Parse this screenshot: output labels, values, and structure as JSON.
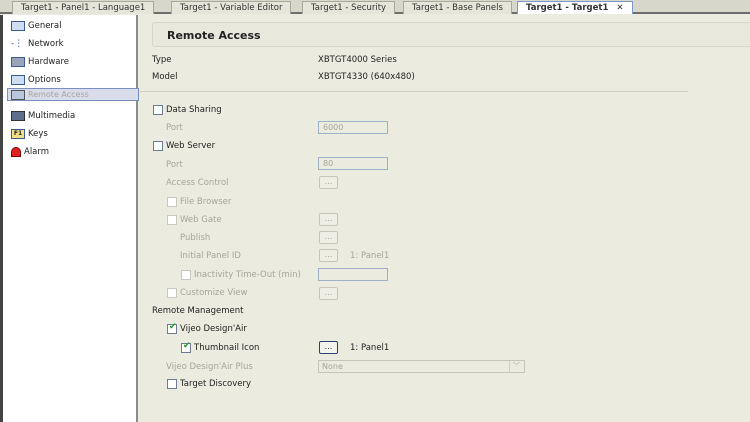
{
  "tabs": [
    {
      "label": "Target1 - Panel1 - Language1"
    },
    {
      "label": "Target1 - Variable Editor"
    },
    {
      "label": "Target1 - Security"
    },
    {
      "label": "Target1 - Base Panels"
    },
    {
      "label": "Target1 - Target1",
      "active": true,
      "close": "✕"
    }
  ],
  "sidebar": {
    "items": [
      {
        "label": "General",
        "icon": "window-icon"
      },
      {
        "label": "Network",
        "icon": "network-icon"
      },
      {
        "label": "Hardware",
        "icon": "hardware-icon"
      },
      {
        "label": "Options",
        "icon": "options-icon"
      },
      {
        "label": "Remote Access",
        "icon": "remote-access-icon",
        "selected": true
      },
      {
        "label": "Multimedia",
        "icon": "multimedia-icon"
      },
      {
        "label": "Keys",
        "icon": "keys-icon",
        "glyph": "F1"
      },
      {
        "label": "Alarm",
        "icon": "alarm-icon"
      }
    ]
  },
  "main": {
    "title": "Remote Access",
    "type_label": "Type",
    "type_value": "XBTGT4000 Series",
    "model_label": "Model",
    "model_value": "XBTGT4330 (640x480)",
    "data_sharing": "Data Sharing",
    "port_label": "Port",
    "port1_value": "6000",
    "web_server": "Web Server",
    "port2_value": "80",
    "access_control": "Access Control",
    "file_browser": "File Browser",
    "web_gate": "Web Gate",
    "publish": "Publish",
    "initial_panel_id": "Initial Panel ID",
    "initial_panel_value": "1: Panel1",
    "inactivity": "Inactivity Time-Out (min)",
    "customize_view": "Customize View",
    "remote_management": "Remote Management",
    "vijeo_designair": "Vijeo Design'Air",
    "thumbnail_icon": "Thumbnail Icon",
    "thumbnail_value": "1: Panel1",
    "vijeo_plus": "Vijeo Design'Air Plus",
    "vijeo_plus_value": "None",
    "target_discovery": "Target Discovery",
    "ellipsis": "..."
  }
}
